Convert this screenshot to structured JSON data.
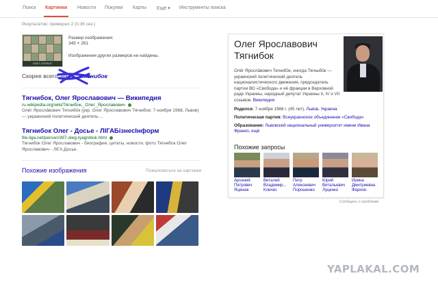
{
  "nav": {
    "tabs": [
      "Поиск",
      "Картинки",
      "Новости",
      "Покупки",
      "Карты",
      "Ещё ▾",
      "Инструменты поиска"
    ],
    "active": "Картинки"
  },
  "results_stats": "Результатов: примерно 2 (0,36 сек.)",
  "image_info": {
    "size_label": "Размер изображения:",
    "size_value": "345 × 261",
    "other_sizes": "Изображения других размеров не найдены.",
    "thumb_caption": "ОЧЕТ ОТКРЫТ"
  },
  "best_guess": {
    "prefix": "Скорее всего, на",
    "query": "Тягнибок"
  },
  "results": [
    {
      "title": "Тягнибок, Олег Ярославович — Википедия",
      "url": "ru.wikipedia.org/wiki/Тягнибок,_Олег_Ярославович",
      "snippet": "Оле́г Яросла́вович Тягнибо́к (укр. Олег Ярославович Тягнибок; 7 ноября 1968, Львов) — украинский политический деятель ..."
    },
    {
      "title": "Тягнибок Олег - Досье - ЛІГАБізнесІнформ",
      "url": "file.liga.net/person/397-oleg-tyagnibok.html",
      "snippet": "Тягнибок Олег Ярославович - биография, цитаты, новости, фото Тягнибок Олег Ярославович - ЛІГА.Досье."
    }
  ],
  "similar": {
    "heading": "Похожие изображения",
    "report_link": "Пожаловаться на картинки"
  },
  "knowledge_panel": {
    "name": "Олег Ярославович Тягнибок",
    "description": "Оле́г Яросла́вович Тягнибо́к, иногда Тягныбо́к — украинский политический деятель националистического движения, председатель партии ВО «Свобода» и её фракции в Верховной раде Украины, народный депутат Украины II, IV и VII созывов.",
    "description_link": "Википедия",
    "born_label": "Родился:",
    "born_value": "7 ноября 1968 г. (45 лет),",
    "born_place": "Львов, Украина",
    "party_label": "Политическая партия:",
    "party_value": "Всеукраинское объединение «Свобода»",
    "edu_label": "Образование:",
    "edu_value": "Львовский национальный университет имени Ивана Франко, ещё",
    "related_heading": "Похожие запросы",
    "related": [
      {
        "name": "Арсений Петрович Яценюк"
      },
      {
        "name": "Виталий Владимир... Кличко"
      },
      {
        "name": "Петр Алексеевич Порошенко"
      },
      {
        "name": "Юрий Витальевич Луценко"
      },
      {
        "name": "Ирина Дмитриевна Фарион"
      }
    ],
    "report": "Сообщить о проблеме"
  },
  "watermark": "YAPLAKAL.COM",
  "colors": {
    "link": "#1a0dab",
    "url_green": "#006621",
    "active_tab": "#dd4b39",
    "scribble": "#3b2fd8"
  }
}
